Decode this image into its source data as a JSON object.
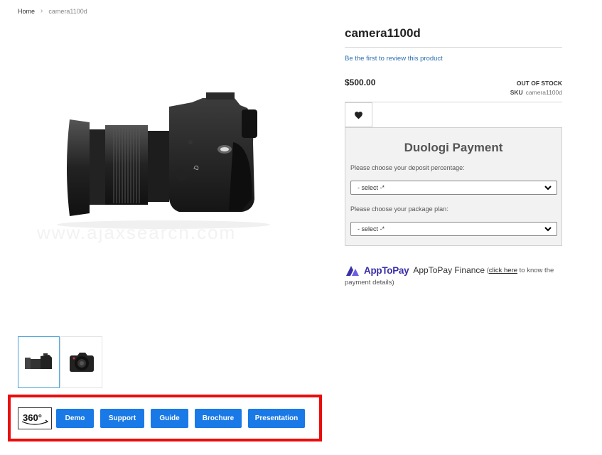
{
  "breadcrumb": {
    "home": "Home",
    "separator": "›",
    "current": "camera1100d"
  },
  "product": {
    "title": "camera1100d",
    "review_link": "Be the first to review this product",
    "price": "$500.00",
    "stock_status": "OUT OF STOCK",
    "sku_label": "SKU",
    "sku_value": "camera1100d"
  },
  "watermark": "www.ajaxsearch.com",
  "wishlist_icon": "heart-icon",
  "duologi": {
    "title": "Duologi Payment",
    "deposit_label": "Please choose your deposit percentage:",
    "deposit_value": "- select -*",
    "plan_label": "Please choose your package plan:",
    "plan_value": "- select -*"
  },
  "apptopay": {
    "brand": "AppToPay",
    "finance_label": "AppToPay Finance",
    "paren_open": "(",
    "click_here": "click here",
    "rest": " to know the payment details)"
  },
  "action_buttons": {
    "btn_360_label": "360°",
    "demo": "Demo",
    "support": "Support",
    "guide": "Guide",
    "brochure": "Brochure",
    "presentation": "Presentation"
  },
  "colors": {
    "button_blue": "#1979e6",
    "highlight_red": "#ec0c0c",
    "link_blue": "#2a6fb4",
    "apptopay_purple": "#3b2fa8"
  }
}
